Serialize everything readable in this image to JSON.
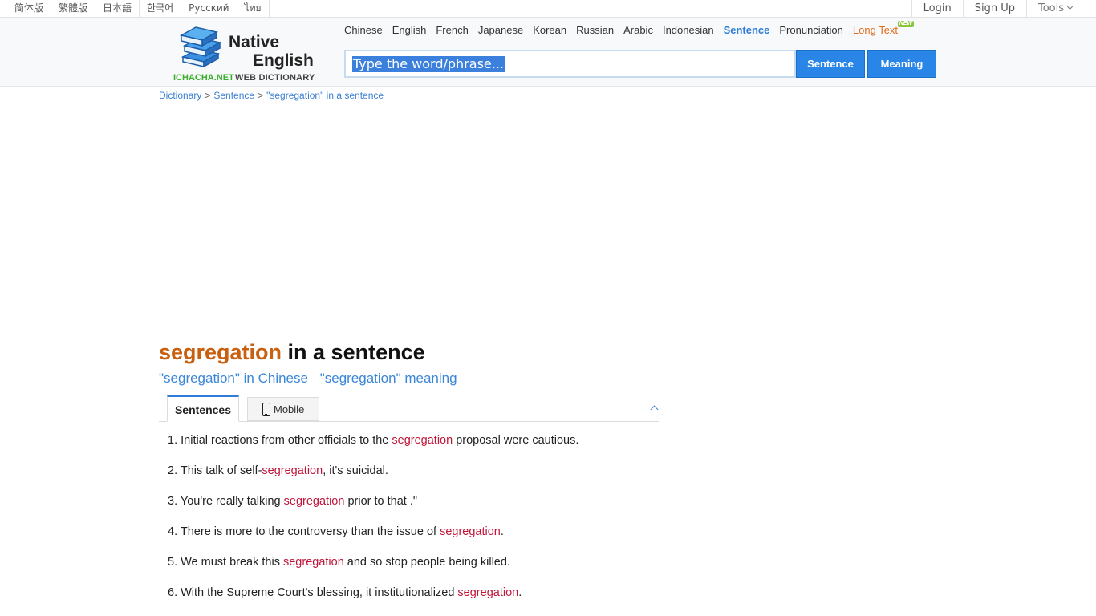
{
  "topbar": {
    "languages": [
      "简体版",
      "繁體版",
      "日本語",
      "한국어",
      "Русский",
      "ไทย"
    ],
    "login": "Login",
    "signup": "Sign Up",
    "tools": "Tools"
  },
  "logo": {
    "line1": "Native",
    "line2": "English",
    "site": "ICHACHA.NET",
    "subtitle": "WEB DICTIONARY"
  },
  "nav": {
    "tabs": [
      "Chinese",
      "English",
      "French",
      "Japanese",
      "Korean",
      "Russian",
      "Arabic",
      "Indonesian",
      "Sentence",
      "Pronunciation",
      "Long Text"
    ],
    "active": "Sentence",
    "new_badge": "NEW"
  },
  "search": {
    "placeholder": "Type the word/phrase...",
    "sentence_button": "Sentence",
    "meaning_button": "Meaning"
  },
  "breadcrumb": {
    "items": [
      "Dictionary",
      "Sentence",
      "\"segregation\" in a sentence"
    ],
    "separator": ">"
  },
  "heading": {
    "keyword": "segregation",
    "rest": " in a sentence"
  },
  "sublinks": {
    "chinese": "\"segregation\" in Chinese",
    "meaning": "\"segregation\" meaning"
  },
  "tabs": {
    "sentences": "Sentences",
    "mobile": "Mobile"
  },
  "sentences": [
    {
      "num": "1.",
      "before": "Initial reactions from other officials to the ",
      "kw": "segregation",
      "after": " proposal were cautious."
    },
    {
      "num": "2.",
      "before": "This talk of self-",
      "kw": "segregation",
      "after": ", it's suicidal."
    },
    {
      "num": "3.",
      "before": "You're really talking ",
      "kw": "segregation",
      "after": " prior to that .\""
    },
    {
      "num": "4.",
      "before": "There is more to the controversy than the issue of ",
      "kw": "segregation",
      "after": "."
    },
    {
      "num": "5.",
      "before": "We must break this ",
      "kw": "segregation",
      "after": " and so stop people being killed."
    },
    {
      "num": "6.",
      "before": "With the Supreme Court's blessing, it institutionalized ",
      "kw": "segregation",
      "after": "."
    }
  ],
  "colors": {
    "accent_blue": "#2f7dd8",
    "keyword_orange": "#c8600f",
    "keyword_red": "#c1163a",
    "logo_green": "#3cae2d"
  }
}
